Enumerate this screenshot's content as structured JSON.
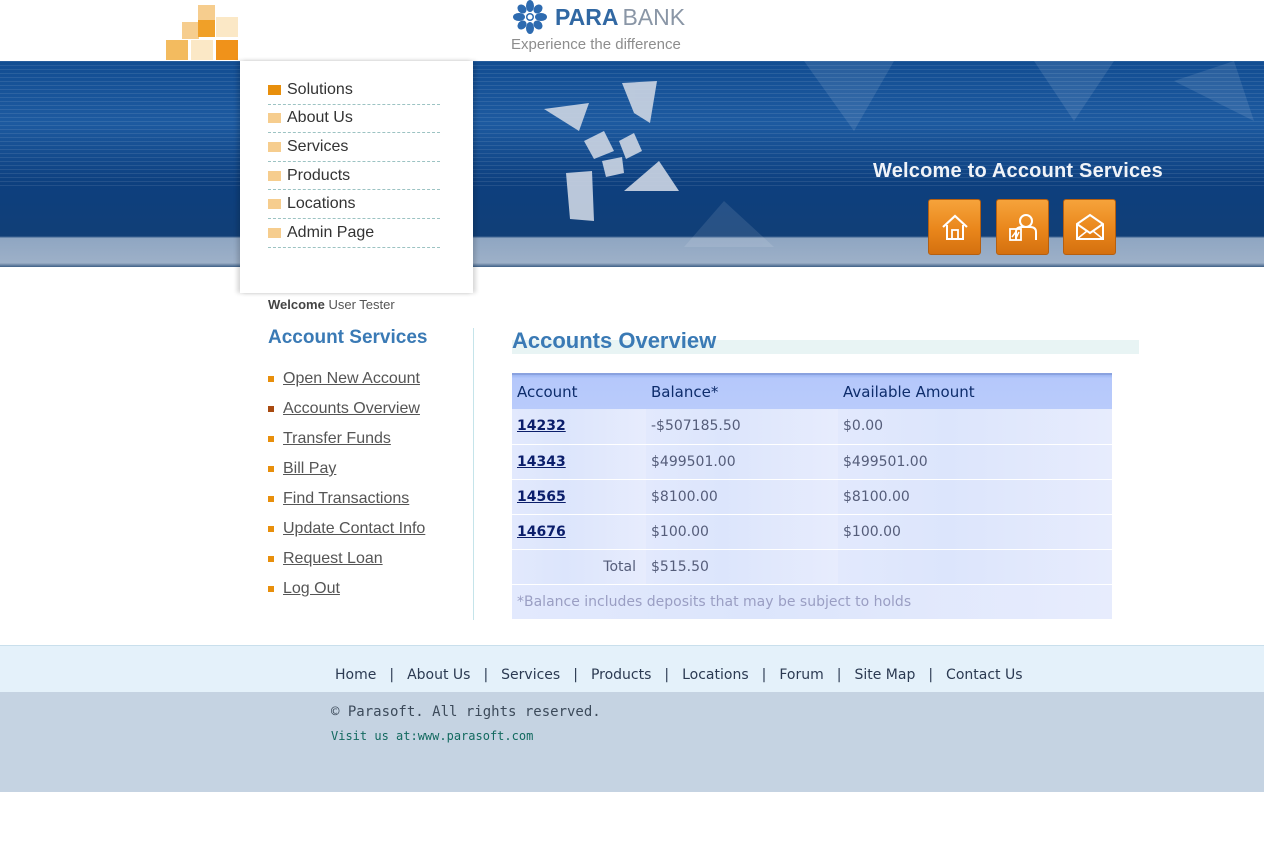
{
  "brand": {
    "name_part1": "PARA",
    "name_part2": "BANK",
    "tagline": "Experience the difference",
    "accent_blue": "#3168a3",
    "accent_orange": "#e88f0c"
  },
  "top_nav": {
    "items": [
      {
        "label": "Solutions",
        "active": true
      },
      {
        "label": "About Us"
      },
      {
        "label": "Services"
      },
      {
        "label": "Products"
      },
      {
        "label": "Locations"
      },
      {
        "label": "Admin Page"
      }
    ]
  },
  "hero": {
    "welcome_text": "Welcome to Account Services",
    "buttons": [
      "home-icon",
      "contact-people-icon",
      "mail-icon"
    ]
  },
  "sidebar": {
    "welcome_label": "Welcome",
    "user_name": "User Tester",
    "title": "Account Services",
    "links": [
      {
        "label": "Open New Account"
      },
      {
        "label": "Accounts Overview",
        "current": true
      },
      {
        "label": "Transfer Funds"
      },
      {
        "label": "Bill Pay"
      },
      {
        "label": "Find Transactions"
      },
      {
        "label": "Update Contact Info"
      },
      {
        "label": "Request Loan"
      },
      {
        "label": "Log Out"
      }
    ]
  },
  "main": {
    "title": "Accounts Overview",
    "columns": [
      "Account",
      "Balance*",
      "Available Amount"
    ],
    "rows": [
      {
        "account": "14232",
        "balance": "-$507185.50",
        "available": "$0.00"
      },
      {
        "account": "14343",
        "balance": "$499501.00",
        "available": "$499501.00"
      },
      {
        "account": "14565",
        "balance": "$8100.00",
        "available": "$8100.00"
      },
      {
        "account": "14676",
        "balance": "$100.00",
        "available": "$100.00"
      }
    ],
    "total_label": "Total",
    "total_value": "$515.50",
    "note": "*Balance includes deposits that may be subject to holds"
  },
  "footer": {
    "links": [
      "Home",
      "About Us",
      "Services",
      "Products",
      "Locations",
      "Forum",
      "Site Map",
      "Contact Us"
    ],
    "separator": "|",
    "copyright": "© Parasoft. All rights reserved.",
    "visit": "Visit us at:www.parasoft.com"
  }
}
